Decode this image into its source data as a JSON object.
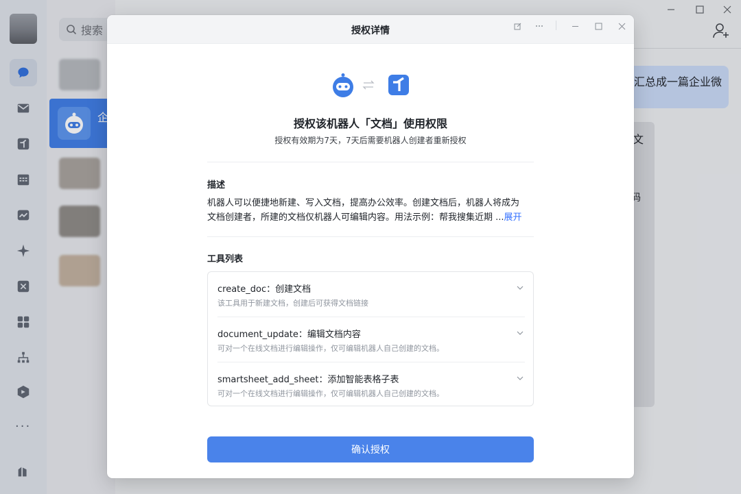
{
  "background_app": {
    "search_label": "搜索",
    "active_conversation_fragment": "企",
    "chat_bubble_fragment": "汇总成一篇企业微",
    "doc_card_fragment": "文",
    "doc_card_fragment2": "码",
    "sidebar_more": "···",
    "nav_icons": [
      "chat-icon",
      "mail-icon",
      "doc-icon",
      "calendar-icon",
      "meeting-icon",
      "ai-spark-icon",
      "workbench-icon",
      "apps-icon",
      "org-chart-icon",
      "drive-icon"
    ],
    "accent_color": "#3e7de6"
  },
  "modal": {
    "title": "授权详情",
    "hero": {
      "title": "授权该机器人「文档」使用权限",
      "subtitle": "授权有效期为7天，7天后需要机器人创建者重新授权"
    },
    "description": {
      "heading": "描述",
      "line1": "机器人可以便捷地新建、写入文档，提高办公效率。创建文档后，机器人将成为",
      "line2": "文档创建者，所建的文档仅机器人可编辑内容。用法示例：帮我搜集近期 ...",
      "expand_label": "展开"
    },
    "tools": {
      "heading": "工具列表",
      "items": [
        {
          "name": "create_doc：创建文档",
          "desc": "该工具用于新建文档，创建后可获得文档链接"
        },
        {
          "name": "document_update：编辑文档内容",
          "desc": "可对一个在线文档进行编辑操作，仅可编辑机器人自己创建的文档。"
        },
        {
          "name": "smartsheet_add_sheet：添加智能表格子表",
          "desc": "可对一个在线文档进行编辑操作，仅可编辑机器人自己创建的文档。"
        }
      ]
    },
    "confirm_label": "确认授权",
    "button_color": "#4a83ea"
  }
}
